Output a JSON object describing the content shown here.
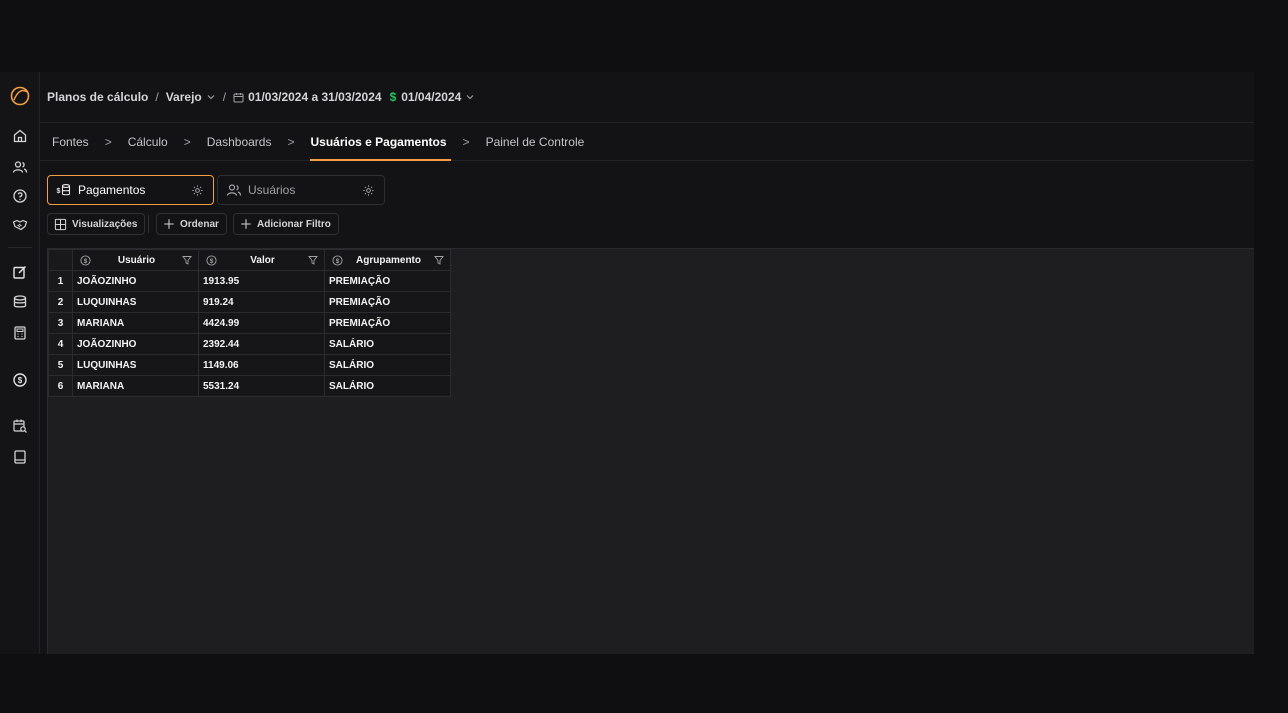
{
  "breadcrumb": {
    "root": "Planos de cálculo",
    "segment": "Varejo",
    "date_range": "01/03/2024 a 31/03/2024",
    "currency_symbol": "$",
    "payment_date": "01/04/2024"
  },
  "steps": [
    {
      "label": "Fontes"
    },
    {
      "label": "Cálculo"
    },
    {
      "label": "Dashboards"
    },
    {
      "label": "Usuários e Pagamentos"
    },
    {
      "label": "Painel de Controle"
    }
  ],
  "active_step": "Usuários e Pagamentos",
  "tabs": [
    {
      "label": "Pagamentos",
      "icon": "database-dollar-icon"
    },
    {
      "label": "Usuários",
      "icon": "users-icon"
    }
  ],
  "toolbar": {
    "views_label": "Visualizações",
    "sort_label": "Ordenar",
    "filter_label": "Adicionar Filtro"
  },
  "table": {
    "columns": [
      "Usuário",
      "Valor",
      "Agrupamento"
    ],
    "rows": [
      {
        "index": "1",
        "usuario": "JOÃOZINHO",
        "valor": "1913.95",
        "agrupamento": "PREMIAÇÃO"
      },
      {
        "index": "2",
        "usuario": "LUQUINHAS",
        "valor": "919.24",
        "agrupamento": "PREMIAÇÃO"
      },
      {
        "index": "3",
        "usuario": "MARIANA",
        "valor": "4424.99",
        "agrupamento": "PREMIAÇÃO"
      },
      {
        "index": "4",
        "usuario": "JOÃOZINHO",
        "valor": "2392.44",
        "agrupamento": "SALÁRIO"
      },
      {
        "index": "5",
        "usuario": "LUQUINHAS",
        "valor": "1149.06",
        "agrupamento": "SALÁRIO"
      },
      {
        "index": "6",
        "usuario": "MARIANA",
        "valor": "5531.24",
        "agrupamento": "SALÁRIO"
      }
    ]
  },
  "sidebar": {
    "icons": [
      "home-icon",
      "users-icon",
      "help-icon",
      "handshake-icon",
      "edit-icon",
      "database-icon",
      "calculator-icon",
      "dollar-icon",
      "calendar-search-icon",
      "book-icon"
    ]
  },
  "colors": {
    "accent": "#f59e42",
    "currency": "#22c55e",
    "background": "#131315"
  }
}
